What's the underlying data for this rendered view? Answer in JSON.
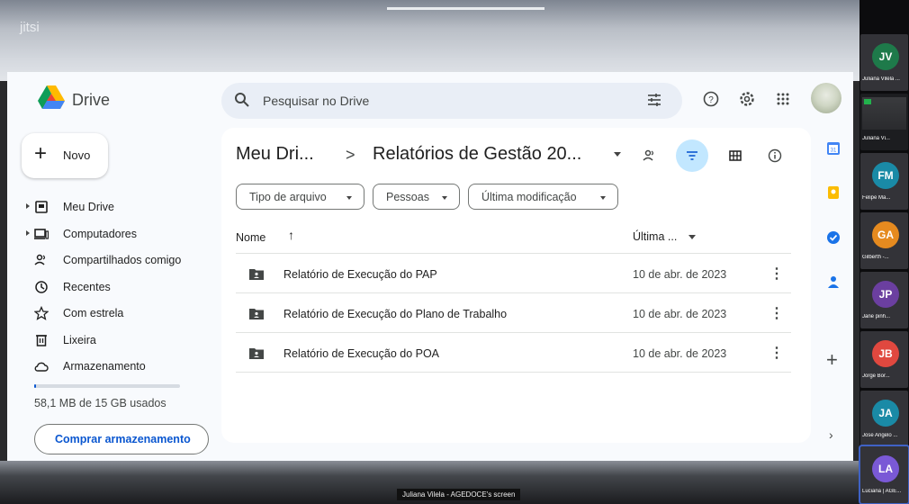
{
  "jitsi": {
    "logo": "jitsi",
    "screen_label": "Juliana Vilela - AGEDOCE's screen"
  },
  "drive": {
    "logo_text": "Drive",
    "search_placeholder": "Pesquisar no Drive",
    "new_button": "Novo",
    "nav": [
      {
        "label": "Meu Drive",
        "icon": "my-drive-icon",
        "expandable": true
      },
      {
        "label": "Computadores",
        "icon": "computer-icon",
        "expandable": true
      },
      {
        "label": "Compartilhados comigo",
        "icon": "shared-icon",
        "expandable": false
      },
      {
        "label": "Recentes",
        "icon": "clock-icon",
        "expandable": false
      },
      {
        "label": "Com estrela",
        "icon": "star-icon",
        "expandable": false
      },
      {
        "label": "Lixeira",
        "icon": "trash-icon",
        "expandable": false
      },
      {
        "label": "Armazenamento",
        "icon": "cloud-icon",
        "expandable": false
      }
    ],
    "storage": {
      "used_text": "58,1 MB de 15 GB usados",
      "fraction_used": 0.004
    },
    "buy_button": "Comprar armazenamento",
    "breadcrumb": {
      "parent": "Meu Dri...",
      "separator": ">",
      "current": "Relatórios de Gestão 20..."
    },
    "filters": [
      "Tipo de arquivo",
      "Pessoas",
      "Última modificação"
    ],
    "columns": {
      "name": "Nome",
      "sort_arrow": "↑",
      "modified": "Última ..."
    },
    "files": [
      {
        "name": "Relatório de Execução do PAP",
        "modified": "10 de abr. de 2023"
      },
      {
        "name": "Relatório de Execução do Plano de Trabalho",
        "modified": "10 de abr. de 2023"
      },
      {
        "name": "Relatório de Execução do POA",
        "modified": "10 de abr. de 2023"
      }
    ],
    "colors": {
      "accent": "#0b57d0",
      "filter_active": "#c2e7ff",
      "search_bg": "#e9eef6"
    }
  },
  "participants": [
    {
      "initials": "JV",
      "name": "Juliana Vilela ...",
      "color": "#1e7a4a"
    },
    {
      "initials": "",
      "name": "Juliana Vi...",
      "color": "#1c1d20",
      "screen": true
    },
    {
      "initials": "FM",
      "name": "Felipe Ma...",
      "color": "#1a8aa6"
    },
    {
      "initials": "GA",
      "name": "Gilberth -...",
      "color": "#e58a1f"
    },
    {
      "initials": "JP",
      "name": "Jane pinh...",
      "color": "#6b3fa0"
    },
    {
      "initials": "JB",
      "name": "Jorge Bor...",
      "color": "#e0483f"
    },
    {
      "initials": "JA",
      "name": "Jose Angelo ...",
      "color": "#1a8aa6"
    },
    {
      "initials": "LA",
      "name": "Luciana | AGE...",
      "color": "#7a59d6"
    }
  ]
}
